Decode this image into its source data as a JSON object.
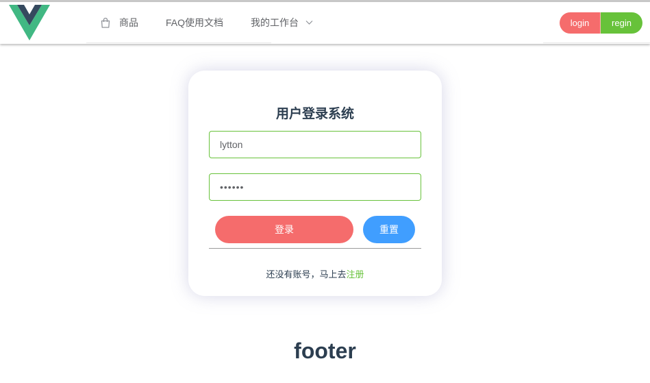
{
  "header": {
    "nav": {
      "products_label": "商品",
      "faq_label": "FAQ使用文档",
      "workbench_label": "我的工作台"
    },
    "auth": {
      "login_label": "login",
      "register_label": "regin"
    }
  },
  "login_card": {
    "title": "用户登录系统",
    "username_value": "lytton",
    "password_value": "••••••",
    "login_button": "登录",
    "reset_button": "重置",
    "signup_prompt": "还没有账号，马上去",
    "signup_link": "注册"
  },
  "footer": {
    "text": "footer"
  },
  "colors": {
    "danger": "#f56c6c",
    "success": "#67c23a",
    "primary": "#409eff",
    "text": "#2c3e50",
    "logo_outer": "#41b883",
    "logo_inner": "#35495e"
  },
  "icons": {
    "logo": "vue-logo",
    "products": "shopping-bag-icon",
    "workbench_dropdown": "chevron-down-icon"
  }
}
